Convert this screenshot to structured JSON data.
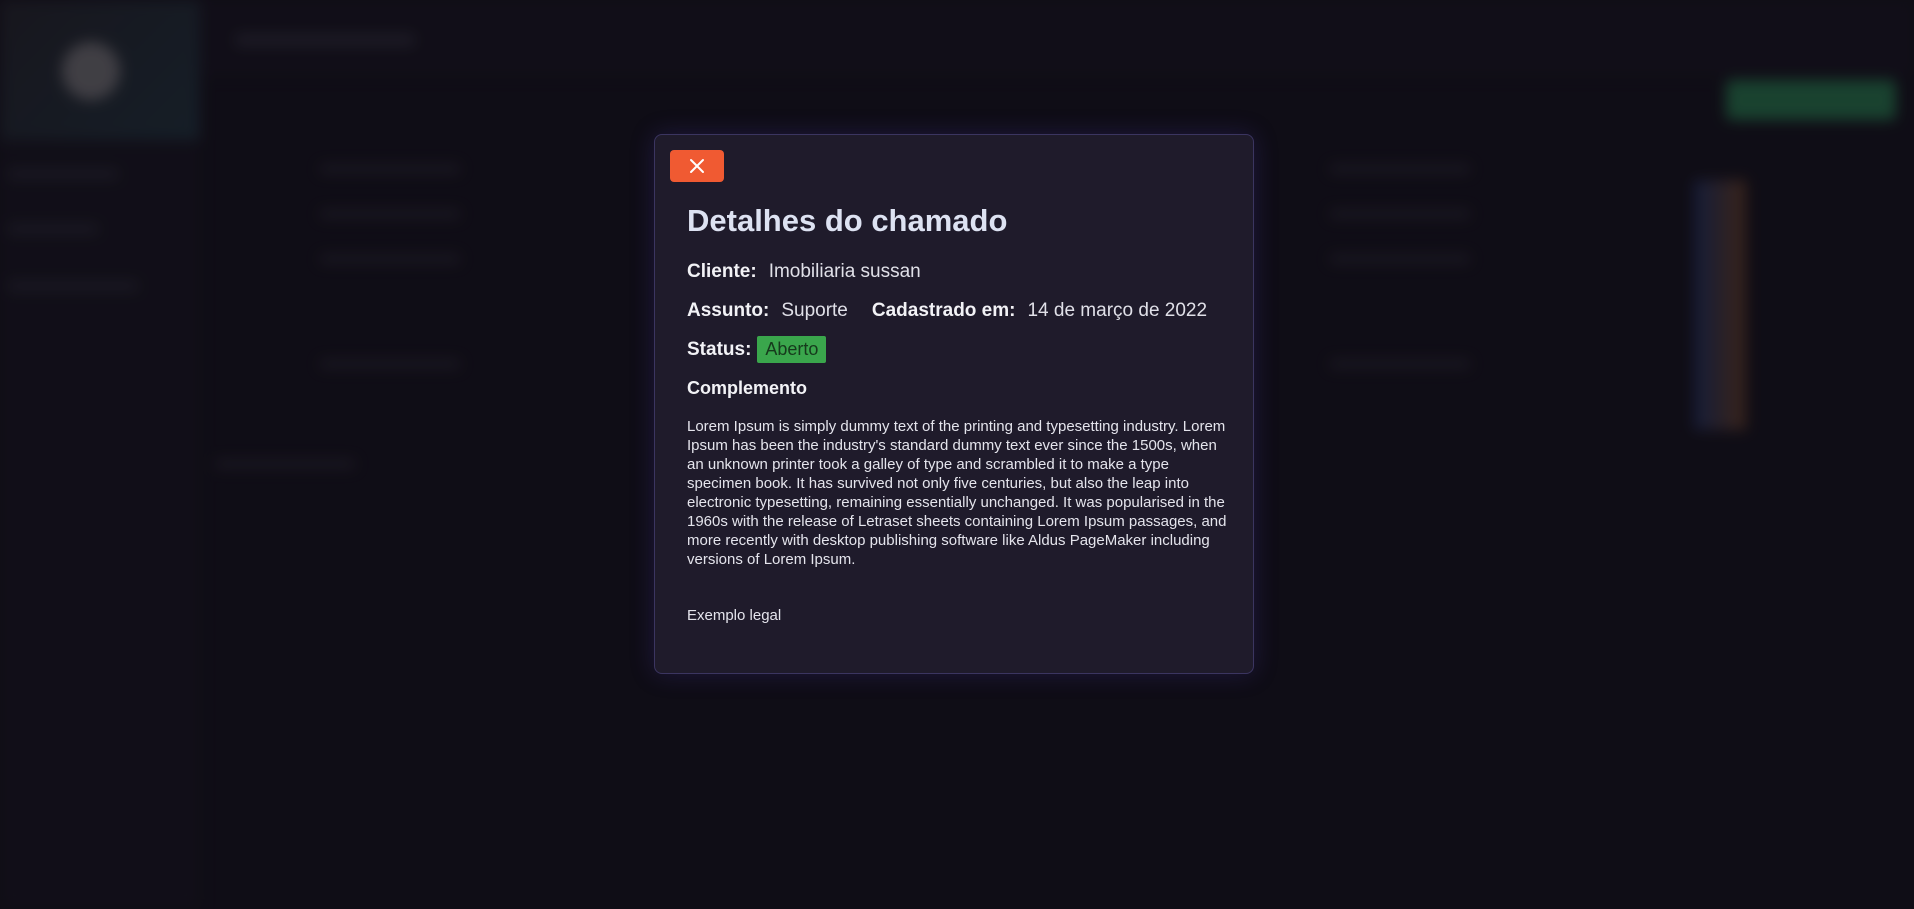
{
  "modal": {
    "title": "Detalhes do chamado",
    "close_icon": "close-icon",
    "client_label": "Cliente:",
    "client_value": "Imobiliaria sussan",
    "subject_label": "Assunto:",
    "subject_value": "Suporte",
    "created_label": "Cadastrado em:",
    "created_value": "14 de março de 2022",
    "status_label": "Status:",
    "status_value": "Aberto",
    "complement_title": "Complemento",
    "complement_text": "Lorem Ipsum is simply dummy text of the printing and typesetting industry. Lorem Ipsum has been the industry's standard dummy text ever since the 1500s, when an unknown printer took a galley of type and scrambled it to make a type specimen book. It has survived not only five centuries, but also the leap into electronic typesetting, remaining essentially unchanged. It was popularised in the 1960s with the release of Letraset sheets containing Lorem Ipsum passages, and more recently with desktop publishing software like Aldus PageMaker including versions of Lorem Ipsum.",
    "extra_text": "Exemplo legal"
  },
  "colors": {
    "close_button": "#f05a32",
    "status_open": "#3aa64c",
    "modal_bg": "#1f1b2b",
    "page_bg": "#121019"
  }
}
